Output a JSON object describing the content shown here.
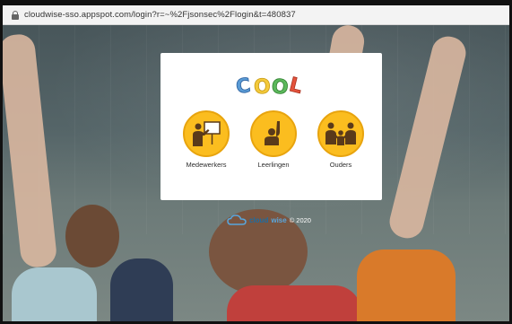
{
  "browser": {
    "url": "cloudwise-sso.appspot.com/login?r=~%2Fjsonsec%2Flogin&t=480837"
  },
  "app": {
    "logo_text": "COOL"
  },
  "roles": [
    {
      "label": "Medewerkers",
      "icon": "teacher-icon"
    },
    {
      "label": "Leerlingen",
      "icon": "student-hand-raised-icon"
    },
    {
      "label": "Ouders",
      "icon": "parents-family-icon"
    }
  ],
  "footer": {
    "brand_part1": "cloud",
    "brand_part2": "wise",
    "copyright": "© 2020"
  },
  "colors": {
    "role_circle": "#fbbd1f",
    "brand_dark": "#1c6ea4",
    "brand_light": "#58a7de"
  }
}
